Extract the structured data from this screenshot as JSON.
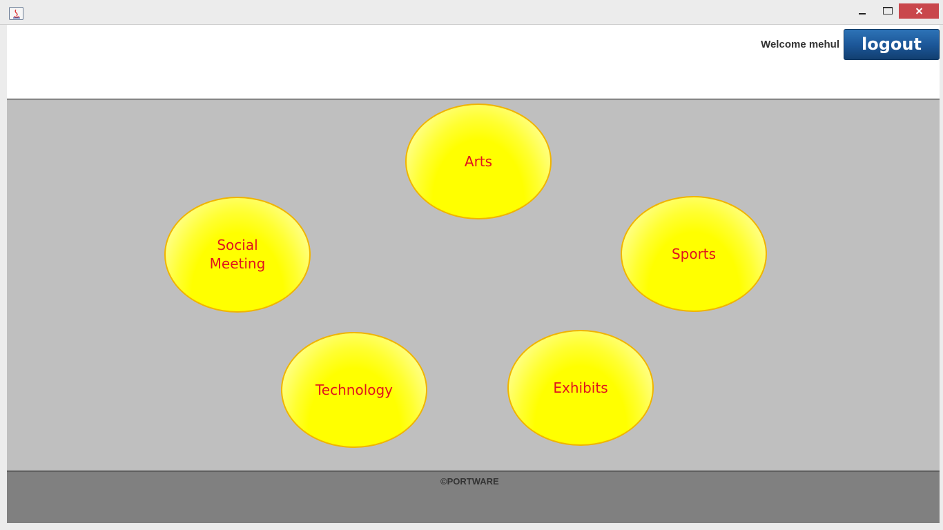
{
  "window": {
    "app_icon": "java-icon",
    "controls": [
      "minimize",
      "maximize",
      "close"
    ]
  },
  "header": {
    "welcome_text": "Welcome mehul",
    "logout_label": "logout"
  },
  "categories": [
    {
      "label": "Arts"
    },
    {
      "label": "Social\nMeeting"
    },
    {
      "label": "Sports"
    },
    {
      "label": "Technology"
    },
    {
      "label": "Exhibits"
    }
  ],
  "footer": {
    "copyright": "©PORTWARE"
  },
  "colors": {
    "main_background": "#bfbfbf",
    "footer_background": "#808080",
    "bubble_fill": "#ffff00",
    "bubble_text": "#e0141e",
    "logout_button": "#1b5596"
  }
}
